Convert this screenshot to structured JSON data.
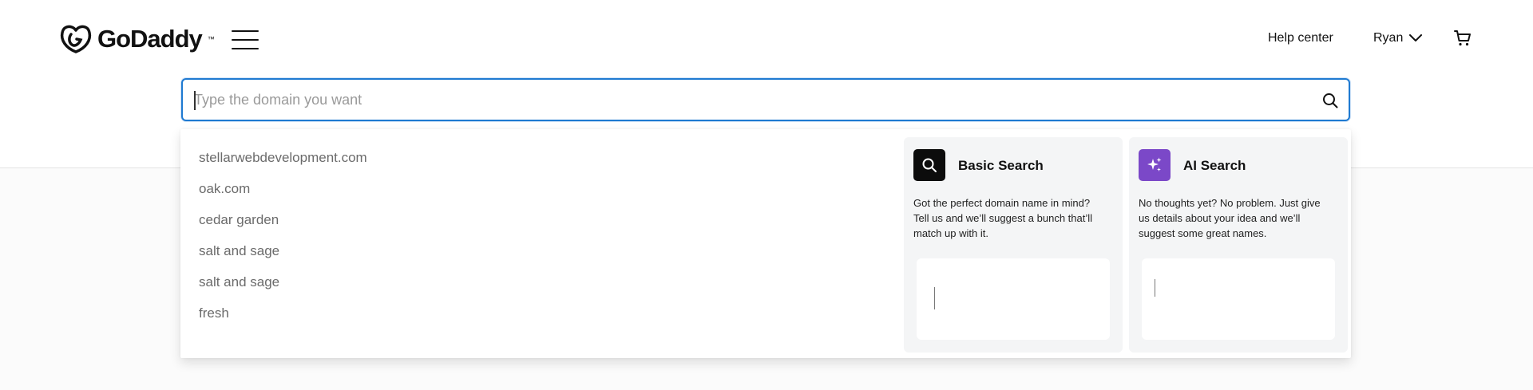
{
  "header": {
    "logo_text": "GoDaddy",
    "logo_tm": "™",
    "menu_icon": "hamburger-menu-icon",
    "help_label": "Help center",
    "user_name": "Ryan",
    "user_chevron_icon": "chevron-down-icon",
    "cart_icon": "shopping-cart-icon"
  },
  "search": {
    "placeholder": "Type the domain you want",
    "value": "",
    "search_icon": "search-icon"
  },
  "suggestions": [
    "stellarwebdevelopment.com",
    "oak.com",
    "cedar garden",
    "salt and sage",
    "salt and sage",
    "fresh"
  ],
  "cards": {
    "basic": {
      "title": "Basic Search",
      "description": "Got the perfect domain name in mind? Tell us and we’ll suggest a bunch that’ll match up with it.",
      "icon": "search-icon"
    },
    "ai": {
      "title": "AI Search",
      "description": "No thoughts yet? No problem. Just give us details about your idea and we’ll suggest some great names.",
      "icon": "sparkle-icon"
    }
  },
  "colors": {
    "accent": "#1f7ad1",
    "ai_purple": "#7b48c8",
    "basic_black": "#0c0c0c"
  }
}
